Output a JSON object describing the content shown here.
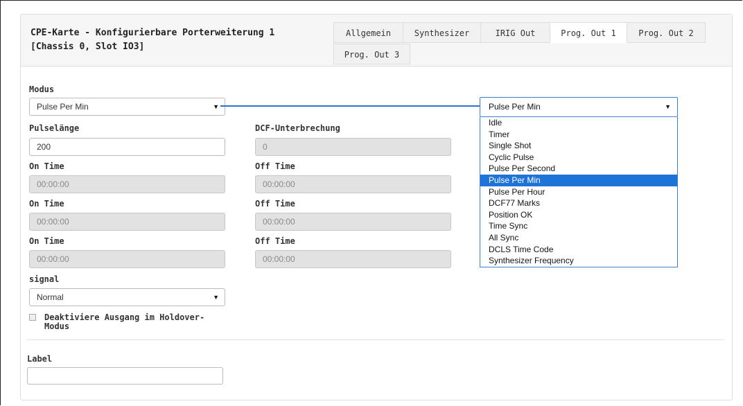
{
  "header": {
    "title_line1": "CPE-Karte - Konfigurierbare Porterweiterung 1",
    "title_line2": "[Chassis 0, Slot IO3]"
  },
  "tabs": [
    {
      "label": "Allgemein",
      "active": false
    },
    {
      "label": "Synthesizer",
      "active": false
    },
    {
      "label": "IRIG Out",
      "active": false
    },
    {
      "label": "Prog. Out 1",
      "active": true
    },
    {
      "label": "Prog. Out 2",
      "active": false
    },
    {
      "label": "Prog. Out 3",
      "active": false
    }
  ],
  "form": {
    "modus_label": "Modus",
    "modus_value": "Pulse Per Min",
    "pulselaenge_label": "Pulselänge",
    "pulselaenge_value": "200",
    "dcf_label": "DCF-Unterbrechung",
    "dcf_value": "0",
    "time_rows": [
      {
        "on_label": "On Time",
        "on_value": "00:00:00",
        "off_label": "Off Time",
        "off_value": "00:00:00"
      },
      {
        "on_label": "On Time",
        "on_value": "00:00:00",
        "off_label": "Off Time",
        "off_value": "00:00:00"
      },
      {
        "on_label": "On Time",
        "on_value": "00:00:00",
        "off_label": "Off Time",
        "off_value": "00:00:00"
      }
    ],
    "signal_label": "signal",
    "signal_value": "Normal",
    "holdover_label_line1": "Deaktiviere Ausgang im Holdover-",
    "holdover_label_line2": "Modus",
    "holdover_checked": false,
    "label_label": "Label",
    "label_value": ""
  },
  "dropdown": {
    "selected": "Pulse Per Min",
    "options": [
      "Idle",
      "Timer",
      "Single Shot",
      "Cyclic Pulse",
      "Pulse Per Second",
      "Pulse Per Min",
      "Pulse Per Hour",
      "DCF77 Marks",
      "Position OK",
      "Time Sync",
      "All Sync",
      "DCLS Time Code",
      "Synthesizer Frequency"
    ],
    "highlighted_index": 5
  },
  "colors": {
    "highlight": "#1e73d8",
    "connector": "#2d6fcc"
  }
}
